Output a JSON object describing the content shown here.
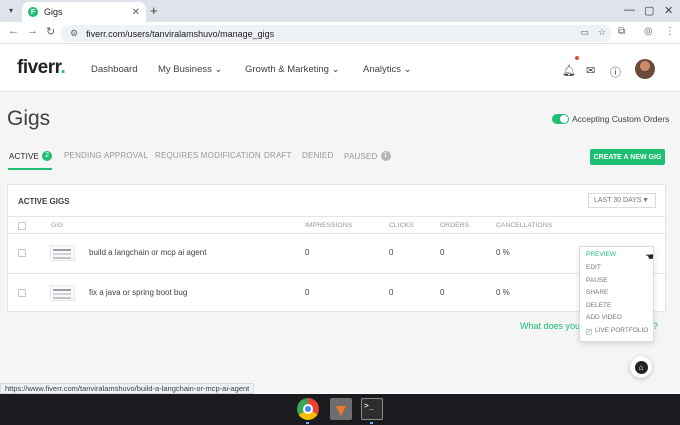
{
  "browser": {
    "tab_title": "Gigs",
    "favicon_letter": "F",
    "new_tab": "+",
    "url": "fiverr.com/users/tanviralamshuvo/manage_gigs"
  },
  "header": {
    "logo": "fiverr",
    "logo_dot": ".",
    "nav": [
      "Dashboard",
      "My Business",
      "Growth & Marketing",
      "Analytics"
    ]
  },
  "page": {
    "title": "Gigs",
    "toggle_label": "Accepting Custom Orders",
    "toggle_on": true,
    "create_button": "CREATE A NEW GIG"
  },
  "tabs": [
    {
      "label": "ACTIVE",
      "count": "2"
    },
    {
      "label": "PENDING APPROVAL"
    },
    {
      "label": "REQUIRES MODIFICATION"
    },
    {
      "label": "DRAFT"
    },
    {
      "label": "DENIED"
    },
    {
      "label": "PAUSED",
      "count": "1"
    }
  ],
  "table": {
    "title": "ACTIVE GIGS",
    "range": "LAST 30 DAYS",
    "columns": [
      "GIG",
      "IMPRESSIONS",
      "CLICKS",
      "ORDERS",
      "CANCELLATIONS"
    ],
    "rows": [
      {
        "gig": "build a langchain or mcp ai agent",
        "impressions": "0",
        "clicks": "0",
        "orders": "0",
        "cancellations": "0 %"
      },
      {
        "gig": "fix a java or spring boot bug",
        "impressions": "0",
        "clicks": "0",
        "orders": "0",
        "cancellations": "0 %"
      }
    ]
  },
  "menu": {
    "items": [
      "PREVIEW",
      "EDIT",
      "PAUSE",
      "SHARE",
      "DELETE",
      "ADD VIDEO",
      "LIVE PORTFOLIO"
    ],
    "active": "PREVIEW"
  },
  "helper_text": "What does you",
  "helper_text_tail": "n?",
  "status_url": "https://www.fiverr.com/tanviralamshuvo/build-a-langchain-or-mcp-ai-agent",
  "colors": {
    "accent": "#1dbf73",
    "text": "#404145",
    "muted": "#95979d"
  }
}
